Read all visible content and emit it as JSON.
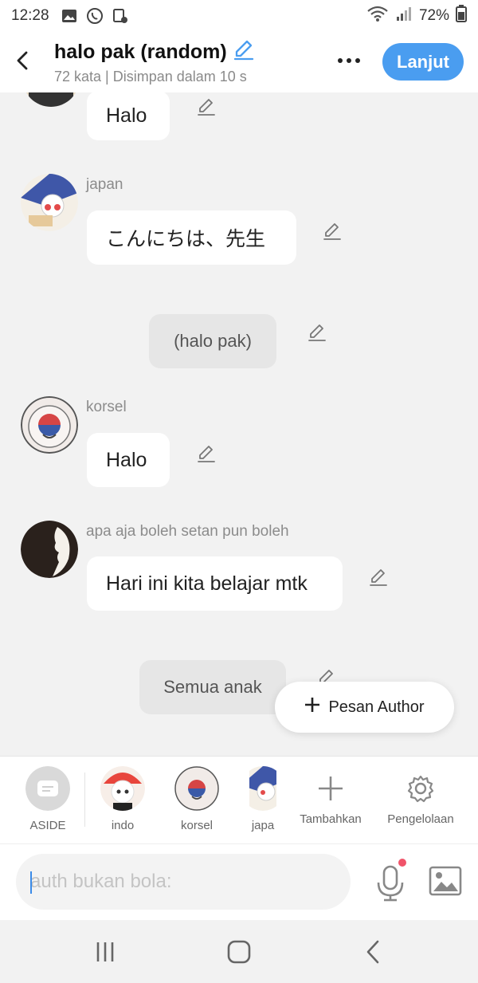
{
  "status_bar": {
    "time": "12:28",
    "battery": "72%"
  },
  "header": {
    "title": "halo pak (random)",
    "subtitle": "72 kata | Disimpan dalam 10 s",
    "next_label": "Lanjut"
  },
  "messages": [
    {
      "sender": "",
      "text": "Halo"
    },
    {
      "sender": "japan",
      "text": "こんにちは、先生"
    },
    {
      "narration": "(halo pak)"
    },
    {
      "sender": "korsel",
      "text": "Halo"
    },
    {
      "sender": "apa aja boleh setan pun boleh",
      "text": "Hari ini kita belajar mtk"
    },
    {
      "narration": "Semua anak"
    }
  ],
  "float_button": {
    "label": "Pesan Author"
  },
  "characters": [
    {
      "name": "ASIDE"
    },
    {
      "name": "indo"
    },
    {
      "name": "korsel"
    },
    {
      "name": "japa"
    },
    {
      "name": "Tambahkan"
    },
    {
      "name": "Pengelolaan"
    }
  ],
  "input": {
    "placeholder": "auth bukan bola:"
  },
  "colors": {
    "accent": "#4a9df0",
    "mic_dot": "#f0546a"
  }
}
